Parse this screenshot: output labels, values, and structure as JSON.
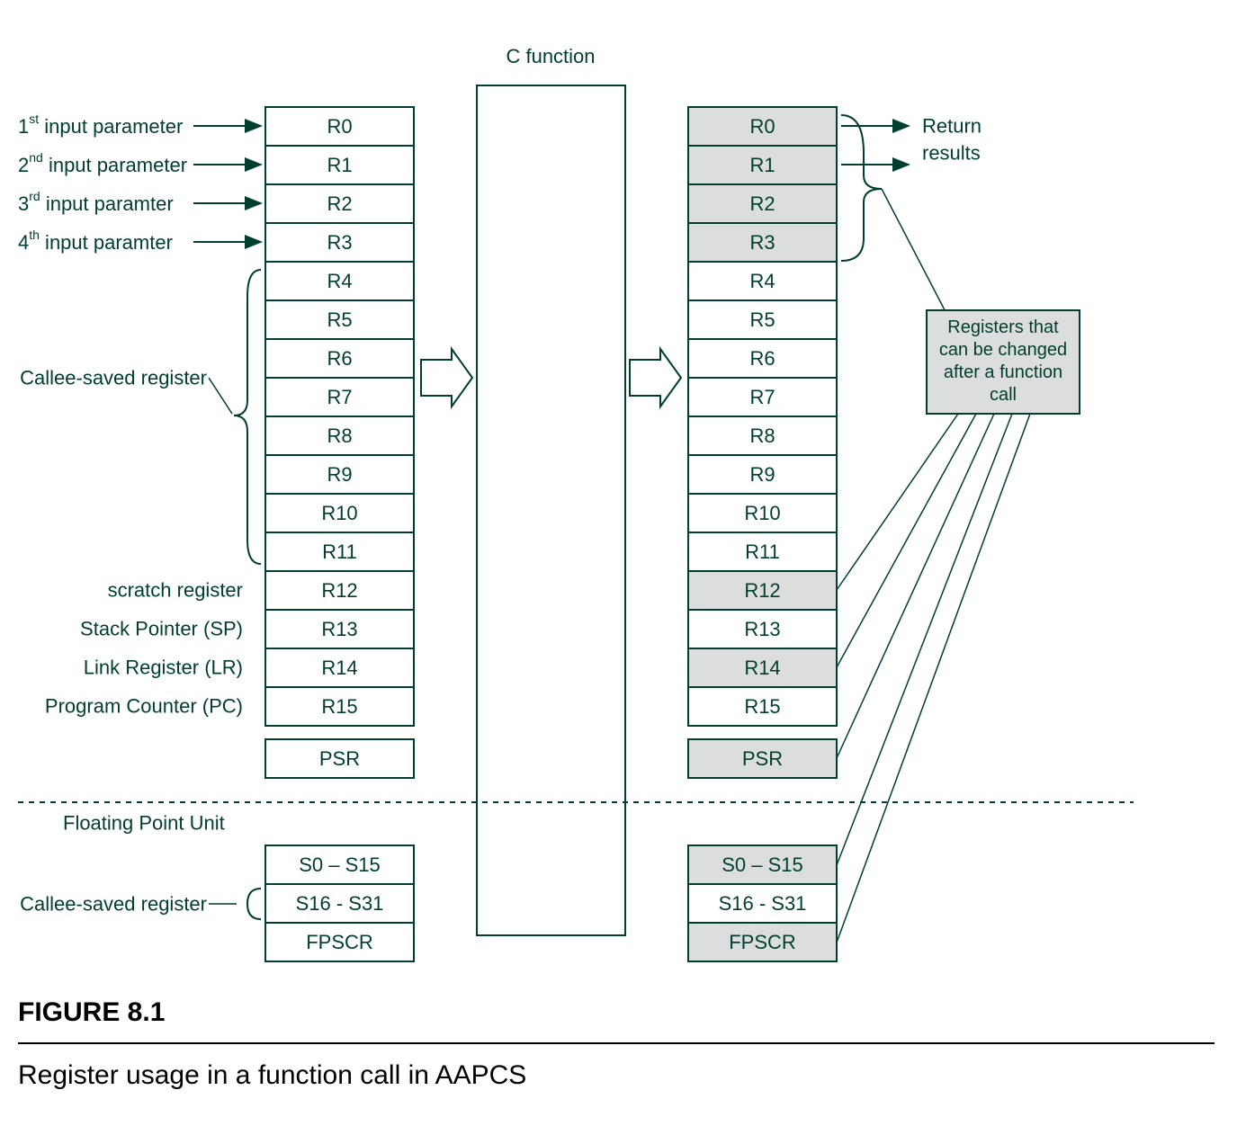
{
  "header": {
    "c_function": "C function"
  },
  "input_labels": {
    "p1_pre": "1",
    "p1_sup": "st",
    "p1_post": " input parameter",
    "p2_pre": "2",
    "p2_sup": "nd",
    "p2_post": " input parameter",
    "p3_pre": "3",
    "p3_sup": "rd",
    "p3_post": " input paramter",
    "p4_pre": "4",
    "p4_sup": "th",
    "p4_post": " input paramter"
  },
  "side_labels": {
    "callee_saved": "Callee-saved register",
    "scratch": "scratch register",
    "sp": "Stack Pointer (SP)",
    "lr": "Link Register (LR)",
    "pc": "Program Counter (PC)",
    "fpu": "Floating Point Unit",
    "callee_saved_fp": "Callee-saved register"
  },
  "right_labels": {
    "return_l1": "Return",
    "return_l2": "results"
  },
  "note_box": {
    "l1": "Registers that",
    "l2": "can be changed",
    "l3": "after a function",
    "l4": "call"
  },
  "registers_left": [
    "R0",
    "R1",
    "R2",
    "R3",
    "R4",
    "R5",
    "R6",
    "R7",
    "R8",
    "R9",
    "R10",
    "R11",
    "R12",
    "R13",
    "R14",
    "R15"
  ],
  "psr_left": "PSR",
  "fp_left": [
    "S0 – S15",
    "S16 - S31",
    "FPSCR"
  ],
  "registers_right": [
    {
      "name": "R0",
      "shaded": true
    },
    {
      "name": "R1",
      "shaded": true
    },
    {
      "name": "R2",
      "shaded": true
    },
    {
      "name": "R3",
      "shaded": true
    },
    {
      "name": "R4",
      "shaded": false
    },
    {
      "name": "R5",
      "shaded": false
    },
    {
      "name": "R6",
      "shaded": false
    },
    {
      "name": "R7",
      "shaded": false
    },
    {
      "name": "R8",
      "shaded": false
    },
    {
      "name": "R9",
      "shaded": false
    },
    {
      "name": "R10",
      "shaded": false
    },
    {
      "name": "R11",
      "shaded": false
    },
    {
      "name": "R12",
      "shaded": true
    },
    {
      "name": "R13",
      "shaded": false
    },
    {
      "name": "R14",
      "shaded": true
    },
    {
      "name": "R15",
      "shaded": false
    }
  ],
  "psr_right": {
    "name": "PSR",
    "shaded": true
  },
  "fp_right": [
    {
      "name": "S0 – S15",
      "shaded": true
    },
    {
      "name": "S16 - S31",
      "shaded": false
    },
    {
      "name": "FPSCR",
      "shaded": true
    }
  ],
  "figure": {
    "title": "FIGURE 8.1",
    "caption": "Register usage in a function call in AAPCS"
  }
}
